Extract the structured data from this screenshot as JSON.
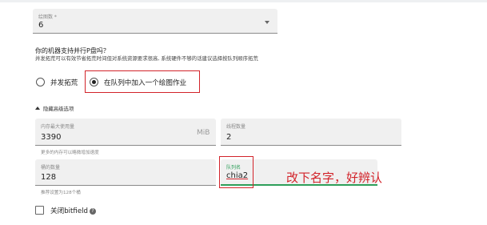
{
  "plot_count": {
    "label": "绘图数 *",
    "value": "6"
  },
  "parallel_question": {
    "title": "你的机器支持并行P盘吗？",
    "description": "并发拓荒可以有效节省拓荒时间但对系统资源要求很高, 系统硬件不够的话建议选择按队列顺序拓荒"
  },
  "radio_options": [
    {
      "label": "并发拓荒",
      "selected": false
    },
    {
      "label": "在队列中加入一个绘图作业",
      "selected": true
    }
  ],
  "advanced_toggle": {
    "label": "隐藏高级选项"
  },
  "max_memory": {
    "label": "内存最大使用量",
    "value": "3390",
    "unit": "MiB",
    "hint": "更多的内存可以略微增加速度"
  },
  "threads": {
    "label": "线程数量",
    "value": "2"
  },
  "buckets": {
    "label": "桶的数量",
    "value": "128",
    "hint": "推荐设置为128个桶"
  },
  "queue_name": {
    "label": "队列名",
    "value": "chia2"
  },
  "annotation": {
    "text": "改下名字，好辨认"
  },
  "bitfield": {
    "label": "关闭bitfield"
  },
  "colors": {
    "accent_red": "#d2232a",
    "focus_green": "#2e9f5a",
    "field_bg": "#f0f0f0"
  }
}
